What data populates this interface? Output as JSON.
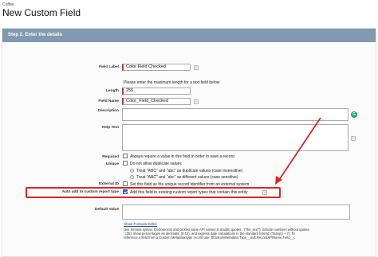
{
  "header": {
    "object_label": "Coffee",
    "page_title": "New Custom Field"
  },
  "step": {
    "title": "Step 2. Enter the details"
  },
  "form": {
    "field_label": {
      "label": "Field Label",
      "value": "Color Field Checked"
    },
    "length_hint": "Please enter the maximum length for a text field below",
    "length": {
      "label": "Length",
      "value": "255"
    },
    "field_name": {
      "label": "Field Name",
      "value": "Color_Field_Checked"
    },
    "description": {
      "label": "Description"
    },
    "help_text": {
      "label": "Help Text"
    },
    "required": {
      "label": "Required",
      "text": "Always require a value in this field in order to save a record"
    },
    "unique": {
      "label": "Unique",
      "text": "Do not allow duplicate values",
      "option1": "Treat \"ABC\" and \"abc\" as duplicate values (case insensitive)",
      "option2": "Treat \"ABC\" and \"abc\" as different values (case sensitive)"
    },
    "external_id": {
      "label": "External ID",
      "text": "Set this field as the unique record identifier from an external system"
    },
    "auto_add": {
      "label": "Auto add to custom report type",
      "text": "Add this field to existing custom report types that contain this entity",
      "checked": true
    },
    "default_value": {
      "label": "Default Value",
      "link": "Show Formula Editor",
      "help_line1": "Use formula syntax: Enclose text and picklist value API names in double quotes : (\"the_text\"), include numbers without quotes",
      "help_line2": ": (25), show percentages as decimals: (0.10), and express date calculations in the standard format: (Today() + 7). To",
      "help_line3": "reference a field from a Custom Metadata type record use: $CustomMetadata.Type__mdt.RecordAPIName.Field__c"
    }
  },
  "icons": {
    "info": "info-icon",
    "grammarly": "grammarly-icon",
    "annotation_arrow": "red-arrow-annotation"
  },
  "colors": {
    "step_bar": "#8199b1",
    "highlight": "#e02424",
    "required_marker": "#c23934",
    "checkbox": "#1b5fd1"
  }
}
